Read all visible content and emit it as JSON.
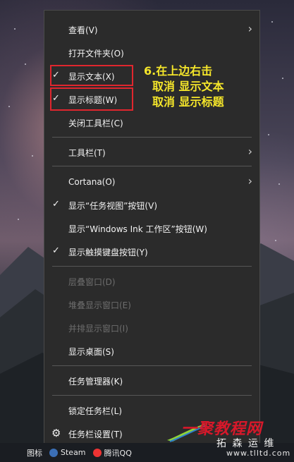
{
  "menu": {
    "items": [
      {
        "label": "查看(V)",
        "submenu": true
      },
      {
        "label": "打开文件夹(O)"
      },
      {
        "label": "显示文本(X)",
        "checked": true
      },
      {
        "label": "显示标题(W)",
        "checked": true
      },
      {
        "label": "关闭工具栏(C)"
      },
      {
        "label": "工具栏(T)",
        "submenu": true
      },
      {
        "label": "Cortana(O)",
        "submenu": true
      },
      {
        "label": "显示“任务视图”按钮(V)",
        "checked": true
      },
      {
        "label": "显示“Windows Ink 工作区”按钮(W)"
      },
      {
        "label": "显示触摸键盘按钮(Y)",
        "checked": true
      },
      {
        "label": "层叠窗口(D)",
        "disabled": true
      },
      {
        "label": "堆叠显示窗口(E)",
        "disabled": true
      },
      {
        "label": "并排显示窗口(I)",
        "disabled": true
      },
      {
        "label": "显示桌面(S)"
      },
      {
        "label": "任务管理器(K)"
      },
      {
        "label": "锁定任务栏(L)"
      },
      {
        "label": "任务栏设置(T)",
        "icon": "gear-icon"
      }
    ]
  },
  "annotation": {
    "line1": "6.在上边右击",
    "line2": "取消   显示文本",
    "line3": "取消   显示标题"
  },
  "taskbar": {
    "items": [
      "图标",
      "Steam",
      "腾讯QQ"
    ]
  },
  "watermark": {
    "top": "一聚教程网",
    "sub": "拓 森 运 维",
    "url": "www.tlltd.com"
  },
  "colors": {
    "menu_bg": "#2b2b2b",
    "highlight_box": "#e0262e",
    "annotation": "#f5e62a",
    "disabled_text": "#6d6d6d"
  }
}
